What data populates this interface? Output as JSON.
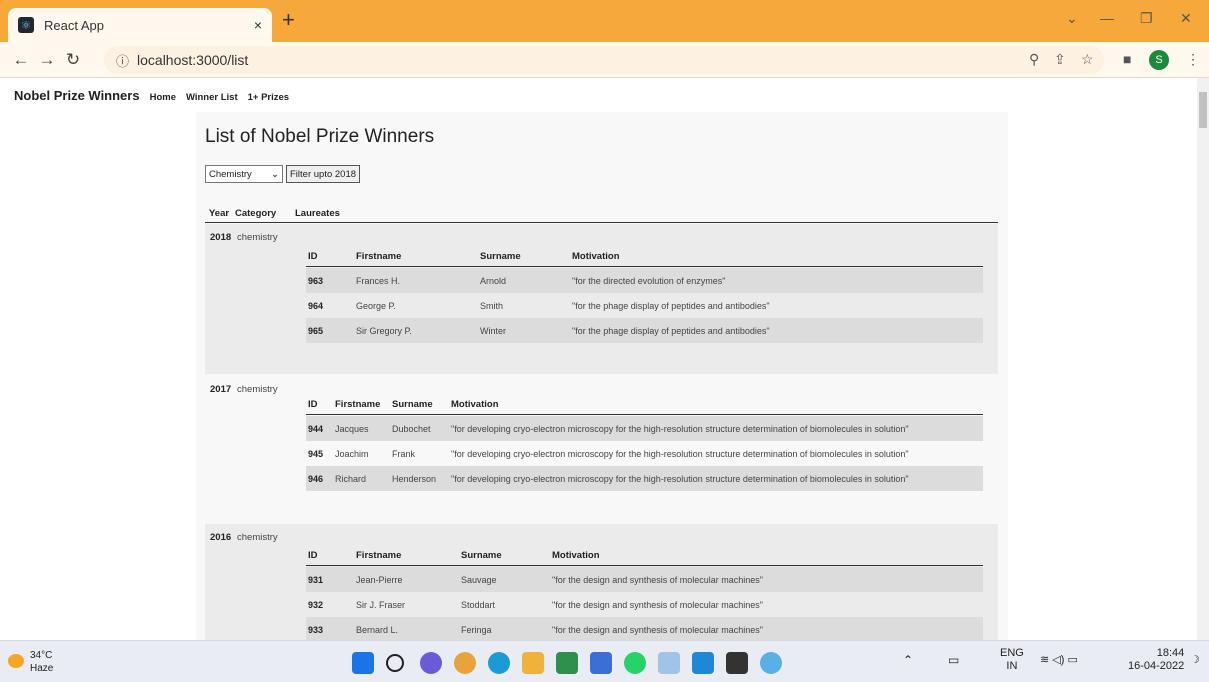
{
  "browser": {
    "tab_title": "React App",
    "tab_close": "×",
    "new_tab": "+",
    "url": "localhost:3000/list",
    "profile_initial": "S"
  },
  "app": {
    "brand": "Nobel Prize Winners",
    "nav": [
      "Home",
      "Winner List",
      "1+ Prizes"
    ]
  },
  "page": {
    "title": "List of Nobel Prize Winners",
    "category_selected": "Chemistry",
    "filter_button": "Filter upto 2018",
    "columns": [
      "Year",
      "Category",
      "Laureates"
    ],
    "laureate_columns": [
      "ID",
      "Firstname",
      "Surname",
      "Motivation"
    ],
    "prizes": [
      {
        "year": "2018",
        "category": "chemistry",
        "laureates": [
          {
            "id": "963",
            "firstname": "Frances H.",
            "surname": "Arnold",
            "motivation": "\"for the directed evolution of enzymes\""
          },
          {
            "id": "964",
            "firstname": "George P.",
            "surname": "Smith",
            "motivation": "\"for the phage display of peptides and antibodies\""
          },
          {
            "id": "965",
            "firstname": "Sir Gregory P.",
            "surname": "Winter",
            "motivation": "\"for the phage display of peptides and antibodies\""
          }
        ]
      },
      {
        "year": "2017",
        "category": "chemistry",
        "laureates": [
          {
            "id": "944",
            "firstname": "Jacques",
            "surname": "Dubochet",
            "motivation": "\"for developing cryo-electron microscopy for the high-resolution structure determination of biomolecules in solution\""
          },
          {
            "id": "945",
            "firstname": "Joachim",
            "surname": "Frank",
            "motivation": "\"for developing cryo-electron microscopy for the high-resolution structure determination of biomolecules in solution\""
          },
          {
            "id": "946",
            "firstname": "Richard",
            "surname": "Henderson",
            "motivation": "\"for developing cryo-electron microscopy for the high-resolution structure determination of biomolecules in solution\""
          }
        ]
      },
      {
        "year": "2016",
        "category": "chemistry",
        "laureates": [
          {
            "id": "931",
            "firstname": "Jean-Pierre",
            "surname": "Sauvage",
            "motivation": "\"for the design and synthesis of molecular machines\""
          },
          {
            "id": "932",
            "firstname": "Sir J. Fraser",
            "surname": "Stoddart",
            "motivation": "\"for the design and synthesis of molecular machines\""
          },
          {
            "id": "933",
            "firstname": "Bernard L.",
            "surname": "Feringa",
            "motivation": "\"for the design and synthesis of molecular machines\""
          }
        ]
      }
    ]
  },
  "taskbar": {
    "temperature": "34°C",
    "weather": "Haze",
    "language_top": "ENG",
    "language_bottom": "IN",
    "time": "18:44",
    "date": "16-04-2022"
  }
}
